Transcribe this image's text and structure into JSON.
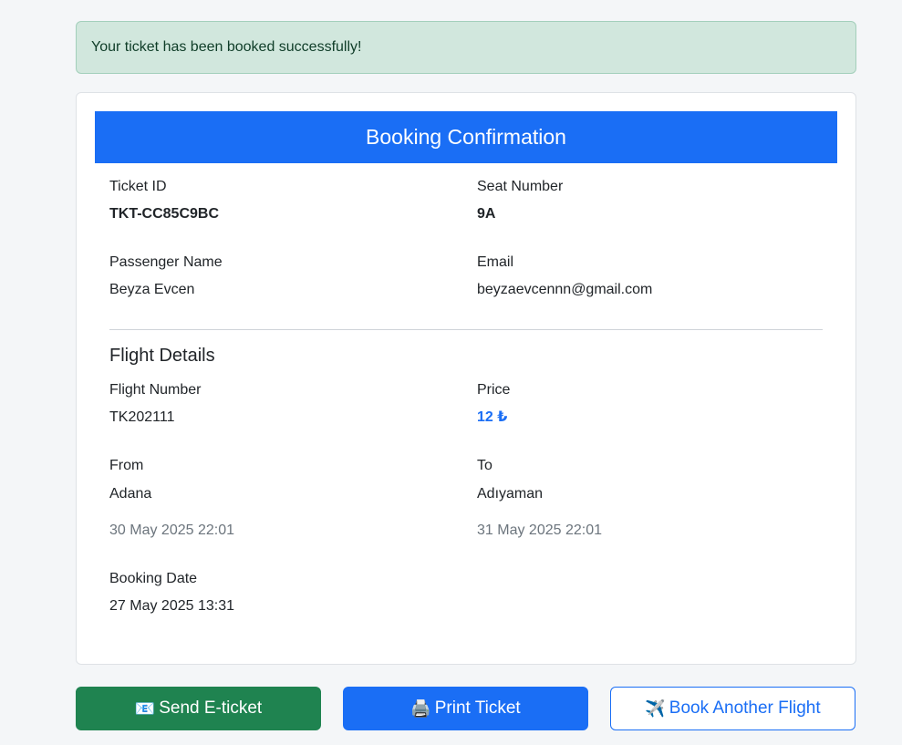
{
  "alert": {
    "message": "Your ticket has been booked successfully!"
  },
  "card": {
    "title": "Booking Confirmation",
    "ticket_id": {
      "label": "Ticket ID",
      "value": "TKT-CC85C9BC"
    },
    "seat_number": {
      "label": "Seat Number",
      "value": "9A"
    },
    "passenger_name": {
      "label": "Passenger Name",
      "value": "Beyza Evcen"
    },
    "email": {
      "label": "Email",
      "value": "beyzaevcennn@gmail.com"
    },
    "flight_section_title": "Flight Details",
    "flight_number": {
      "label": "Flight Number",
      "value": "TK202111"
    },
    "price": {
      "label": "Price",
      "value": "12 ₺"
    },
    "from": {
      "label": "From",
      "city": "Adana",
      "datetime": "30 May 2025 22:01"
    },
    "to": {
      "label": "To",
      "city": "Adıyaman",
      "datetime": "31 May 2025 22:01"
    },
    "booking_date": {
      "label": "Booking Date",
      "value": "27 May 2025 13:31"
    }
  },
  "actions": {
    "send_eticket": {
      "icon": "📧",
      "label": "Send E-ticket"
    },
    "print_ticket": {
      "icon": "🖨️",
      "label": "Print Ticket"
    },
    "book_another": {
      "icon": "✈️",
      "label": "Book Another Flight"
    }
  },
  "colors": {
    "primary": "#1a6ef5",
    "success": "#1f8350",
    "alert_bg": "#d1e7dd"
  }
}
